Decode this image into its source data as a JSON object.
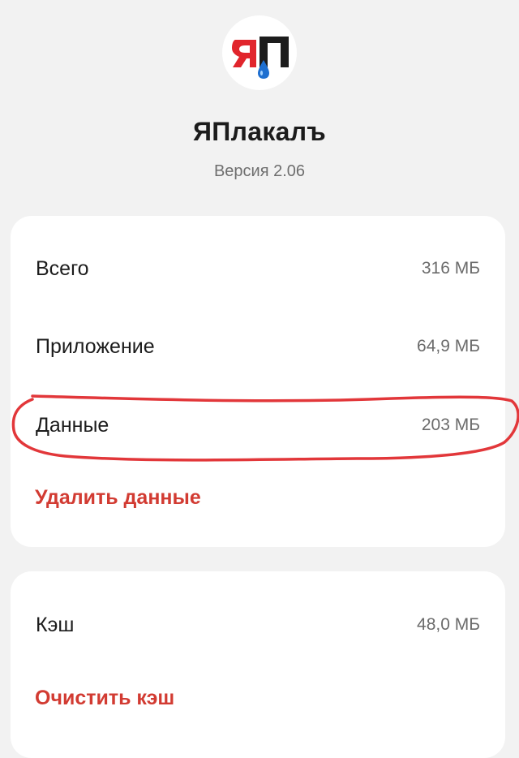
{
  "app": {
    "logo_text": "ЯП",
    "name": "ЯПлакалъ",
    "version": "Версия 2.06"
  },
  "storage": {
    "rows": [
      {
        "label": "Всего",
        "value": "316 МБ"
      },
      {
        "label": "Приложение",
        "value": "64,9 МБ"
      },
      {
        "label": "Данные",
        "value": "203 МБ"
      }
    ],
    "clear_data_label": "Удалить данные"
  },
  "cache": {
    "label": "Кэш",
    "value": "48,0 МБ",
    "clear_cache_label": "Очистить кэш"
  },
  "colors": {
    "background": "#f2f2f2",
    "card": "#ffffff",
    "accent_red": "#d23b32",
    "annotation_red": "#e2373a",
    "logo_red": "#e1252c",
    "logo_blue": "#1e6fd0"
  }
}
